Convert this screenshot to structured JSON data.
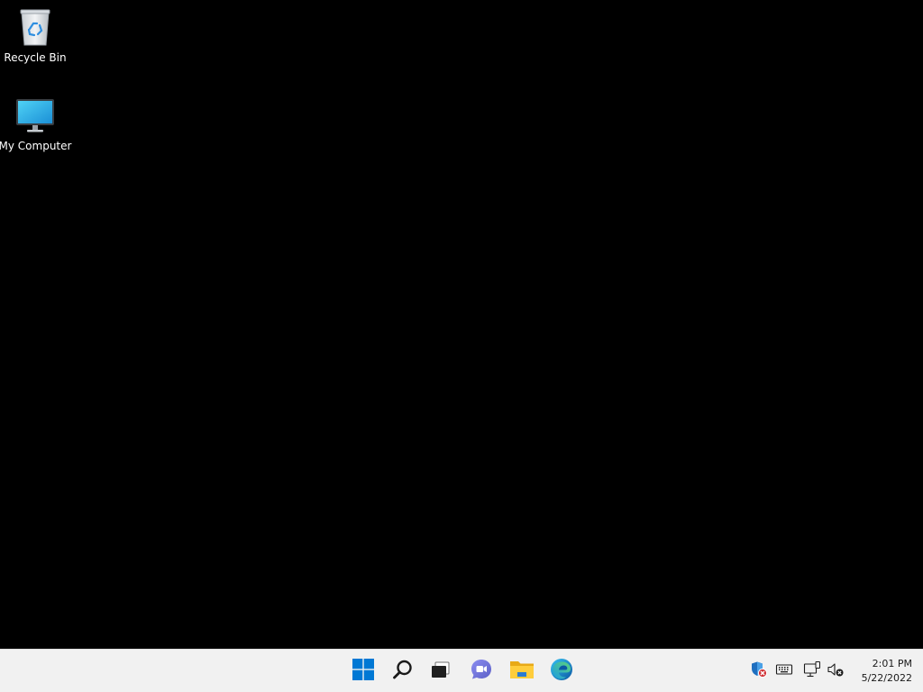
{
  "desktop": {
    "background_color": "#000000",
    "icons": [
      {
        "label": "Recycle Bin",
        "icon": "recycle-bin-icon"
      },
      {
        "label": "My Computer",
        "icon": "monitor-icon"
      }
    ]
  },
  "taskbar": {
    "background_color": "#f1f1f1",
    "pinned": [
      {
        "name": "Start",
        "icon": "windows-logo-icon",
        "color": "#0078d4"
      },
      {
        "name": "Search",
        "icon": "search-icon",
        "color": "#1a1a1a"
      },
      {
        "name": "Task View",
        "icon": "task-view-icon",
        "color": "#1a1a1a"
      },
      {
        "name": "Chat",
        "icon": "chat-icon",
        "color": "#6264a7"
      },
      {
        "name": "File Explorer",
        "icon": "folder-icon",
        "color": "#f4c430"
      },
      {
        "name": "Microsoft Edge",
        "icon": "edge-icon",
        "color": "#0c8bd6"
      }
    ],
    "tray": [
      {
        "name": "Windows Security",
        "icon": "shield-warning-icon"
      },
      {
        "name": "Touch keyboard",
        "icon": "keyboard-icon"
      },
      {
        "name": "Network",
        "icon": "network-icon"
      },
      {
        "name": "Volume",
        "icon": "volume-muted-icon"
      }
    ],
    "clock": {
      "time": "2:01 PM",
      "date": "5/22/2022"
    }
  }
}
